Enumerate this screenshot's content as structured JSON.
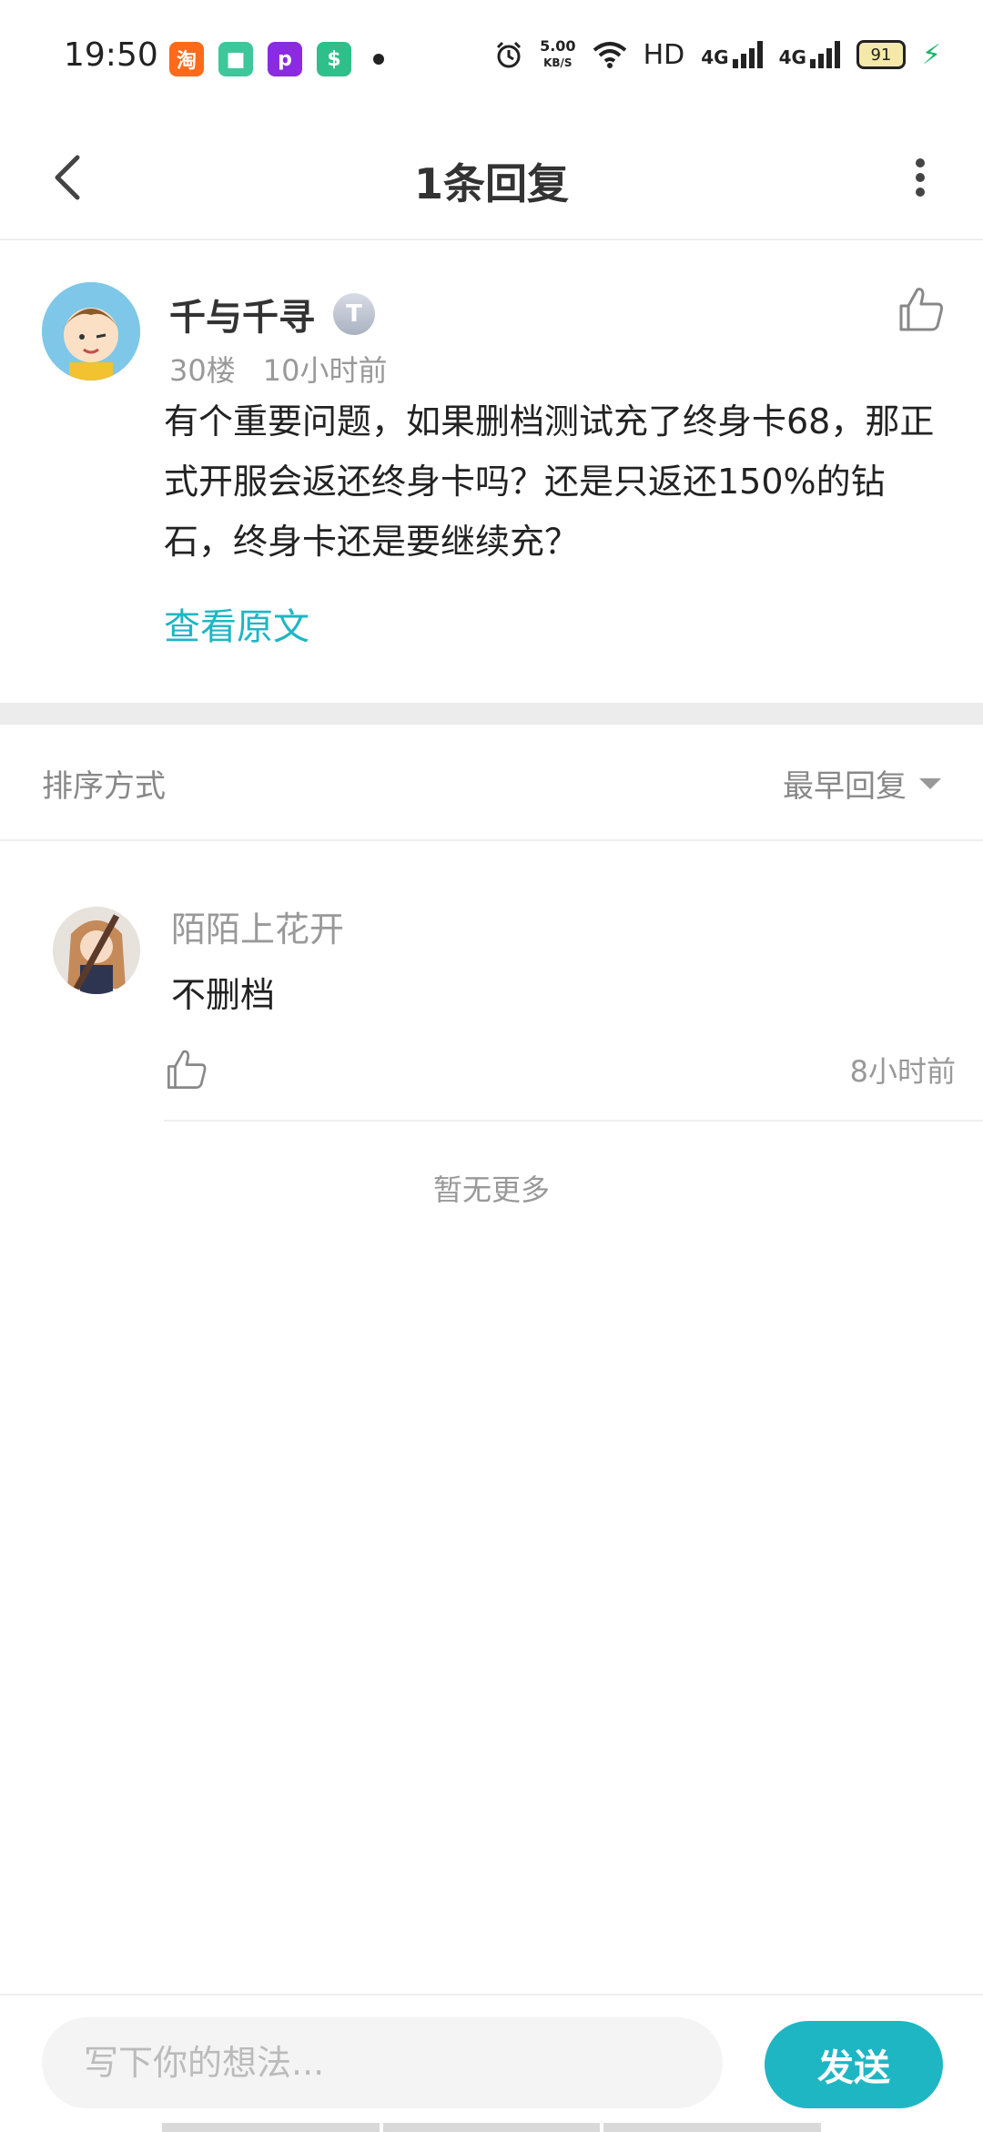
{
  "status_bar": {
    "time": "19:50",
    "net_speed_value": "5.00",
    "net_speed_unit": "KB/S",
    "hd_label": "HD",
    "signal_1": "4G",
    "signal_2": "4G",
    "battery": "91",
    "app_icons": [
      "taobao-icon",
      "app-green-icon",
      "picsart-icon",
      "shield-app-icon"
    ]
  },
  "header": {
    "title": "1条回复"
  },
  "post": {
    "author": "千与千寻",
    "level_badge": "T",
    "floor": "30楼",
    "time": "10小时前",
    "body": "有个重要问题，如果删档测试充了终身卡68，那正式开服会返还终身卡吗？还是只返还150%的钻石，终身卡还是要继续充？",
    "view_original": "查看原文"
  },
  "sort": {
    "label": "排序方式",
    "selected": "最早回复"
  },
  "replies": [
    {
      "author": "陌陌上花开",
      "text": "不删档",
      "time": "8小时前"
    }
  ],
  "list_footer": "暂无更多",
  "composer": {
    "placeholder": "写下你的想法...",
    "send_label": "发送"
  },
  "colors": {
    "accent": "#1fb6c4",
    "muted_text": "#999999",
    "separator": "#ececec"
  }
}
